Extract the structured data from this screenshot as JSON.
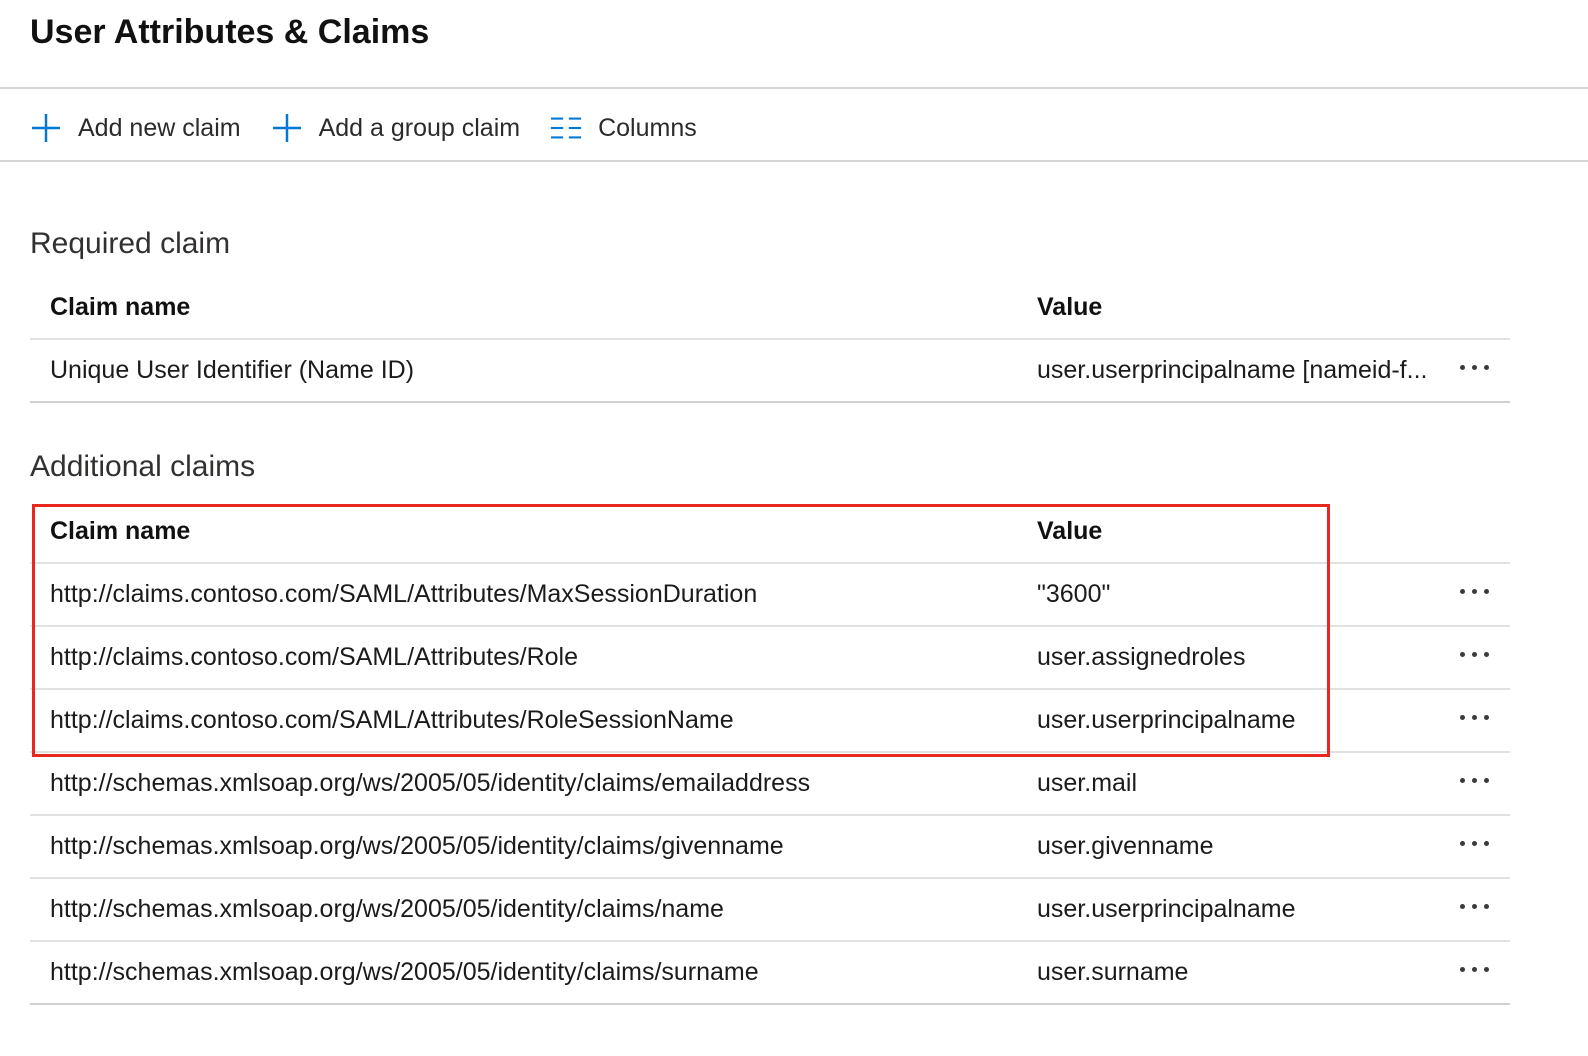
{
  "page": {
    "title": "User Attributes & Claims"
  },
  "toolbar": {
    "add_new_claim": "Add new claim",
    "add_group_claim": "Add a group claim",
    "columns": "Columns",
    "icons": [
      "plus-icon",
      "plus-icon",
      "columns-icon"
    ],
    "accent_color": "#0078d4"
  },
  "required": {
    "title": "Required claim",
    "headers": {
      "name": "Claim name",
      "value": "Value"
    },
    "rows": [
      {
        "name": "Unique User Identifier (Name ID)",
        "value": "user.userprincipalname [nameid-f..."
      }
    ]
  },
  "additional": {
    "title": "Additional claims",
    "headers": {
      "name": "Claim name",
      "value": "Value"
    },
    "highlight_color": "#e8281f",
    "rows": [
      {
        "name": "http://claims.contoso.com/SAML/Attributes/MaxSessionDuration",
        "value": "\"3600\""
      },
      {
        "name": "http://claims.contoso.com/SAML/Attributes/Role",
        "value": "user.assignedroles"
      },
      {
        "name": "http://claims.contoso.com/SAML/Attributes/RoleSessionName",
        "value": "user.userprincipalname"
      },
      {
        "name": "http://schemas.xmlsoap.org/ws/2005/05/identity/claims/emailaddress",
        "value": "user.mail"
      },
      {
        "name": "http://schemas.xmlsoap.org/ws/2005/05/identity/claims/givenname",
        "value": "user.givenname"
      },
      {
        "name": "http://schemas.xmlsoap.org/ws/2005/05/identity/claims/name",
        "value": "user.userprincipalname"
      },
      {
        "name": "http://schemas.xmlsoap.org/ws/2005/05/identity/claims/surname",
        "value": "user.surname"
      }
    ]
  }
}
